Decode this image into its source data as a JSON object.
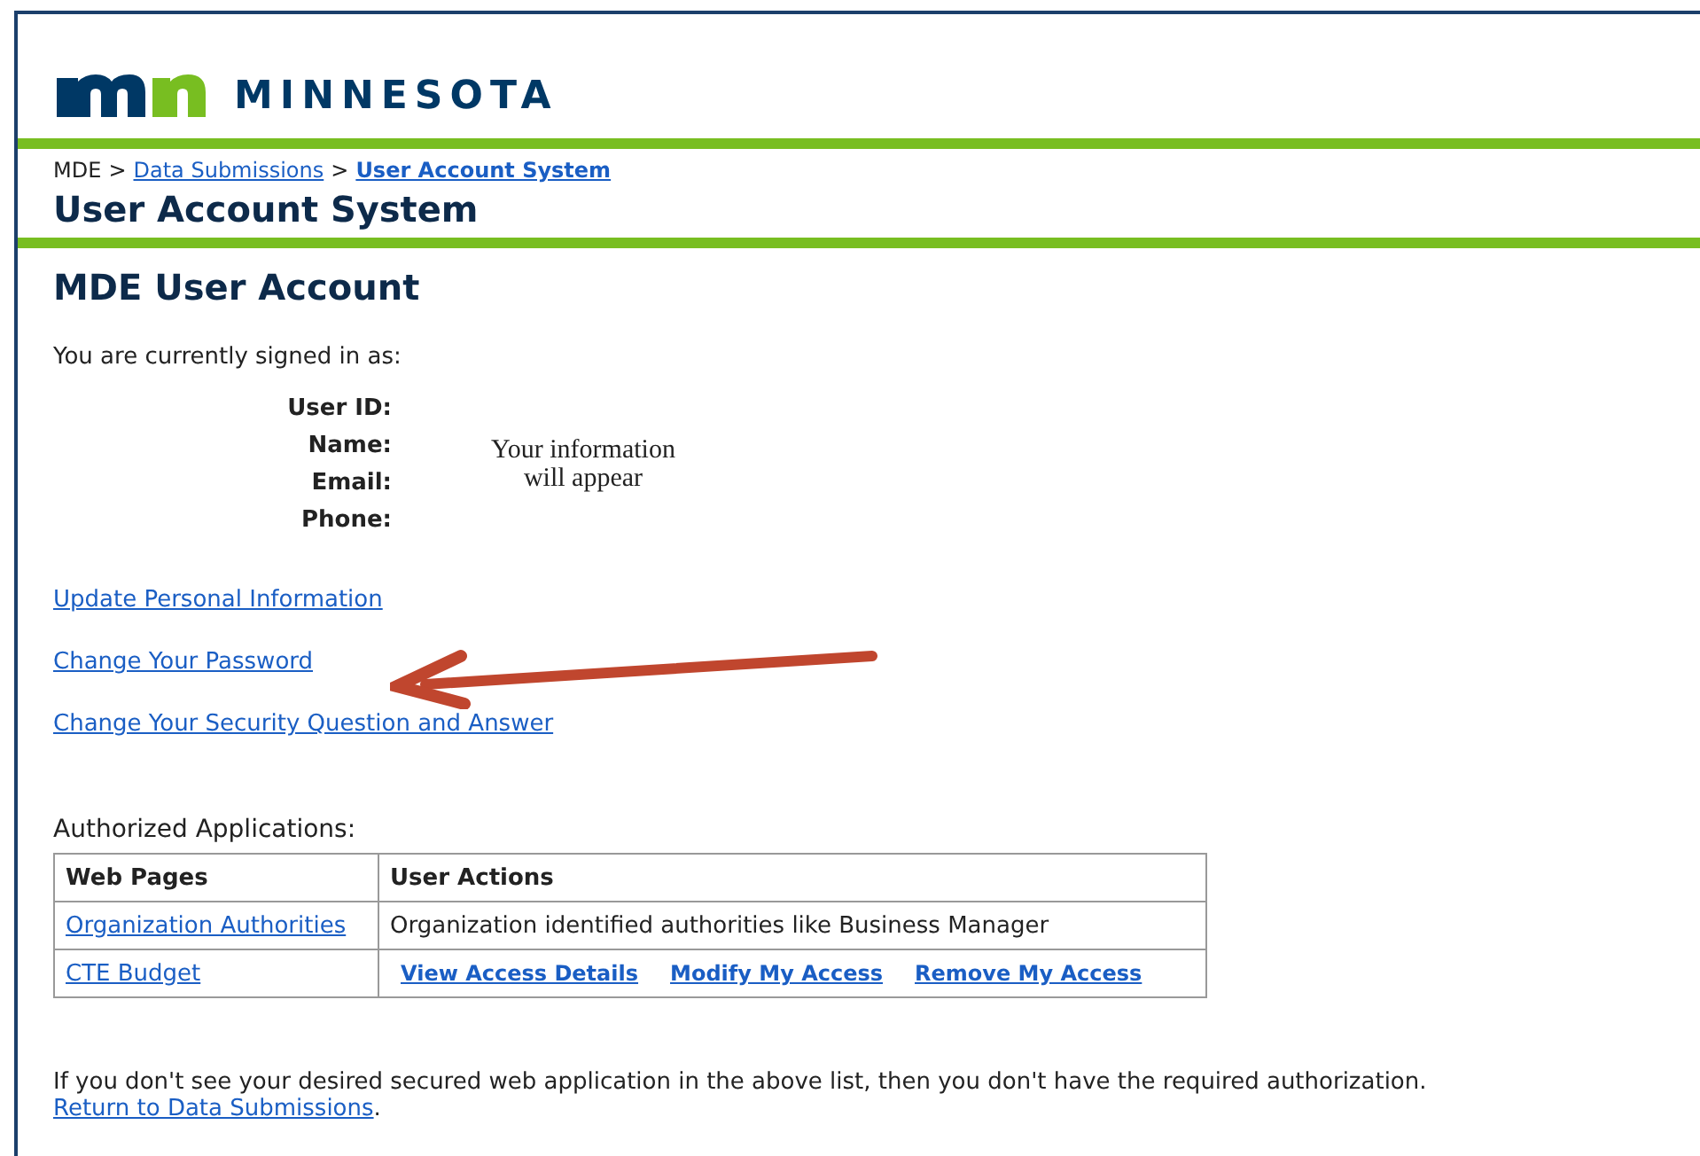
{
  "header": {
    "wordmark": "MINNESOTA"
  },
  "breadcrumb": [
    {
      "label": "MDE",
      "kind": "text"
    },
    {
      "label": ">",
      "kind": "separator"
    },
    {
      "label": "Data Submissions",
      "kind": "link"
    },
    {
      "label": ">",
      "kind": "separator"
    },
    {
      "label": "User Account System",
      "kind": "current"
    }
  ],
  "section_title": "User Account System",
  "page_title": "MDE User Account",
  "signed_in_text": "You are currently signed in as:",
  "fields": [
    {
      "label": "User ID:"
    },
    {
      "label": "Name:"
    },
    {
      "label": "Email:"
    },
    {
      "label": "Phone:"
    }
  ],
  "info_placeholder": "Your information will appear",
  "links": [
    {
      "label": "Update Personal Information"
    },
    {
      "label": "Change Your Password"
    },
    {
      "label": "Change Your Security Question and Answer"
    }
  ],
  "apps_heading": "Authorized Applications:",
  "table": {
    "columns": [
      "Web Pages",
      "User Actions"
    ],
    "rows": [
      {
        "page": "Organization Authorities",
        "kind": "text",
        "actions": [
          "Organization identified authorities like Business Manager"
        ]
      },
      {
        "page": "CTE Budget",
        "kind": "links",
        "actions": [
          "View Access Details",
          "Modify My Access",
          "Remove My Access"
        ]
      }
    ]
  },
  "footer": {
    "note": "If you don't see your desired secured web application in the above list, then you don't have the required authorization.",
    "return_link": "Return to Data Submissions",
    "punctuation": "."
  }
}
